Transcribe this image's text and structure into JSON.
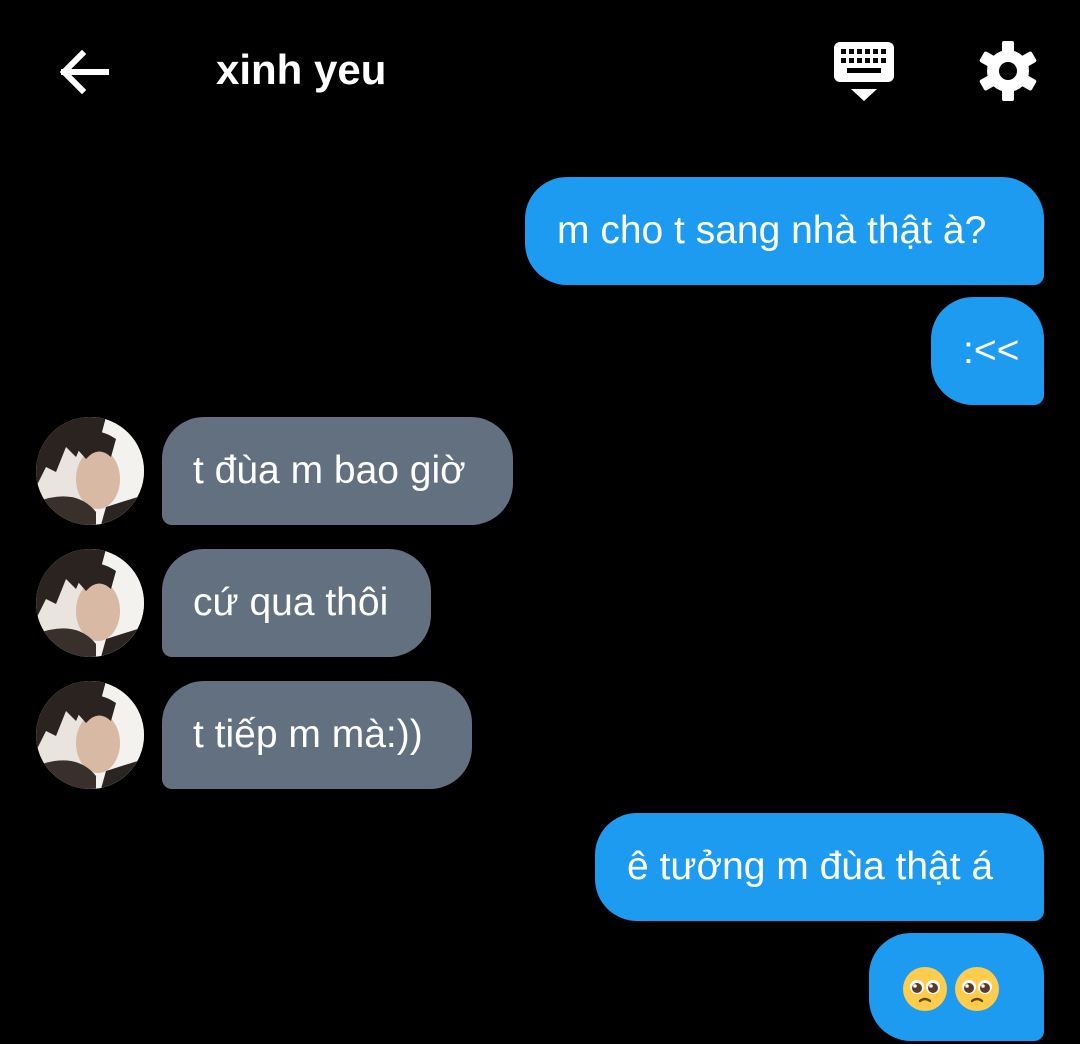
{
  "header": {
    "contact_name": "xinh yeu",
    "back_icon": "arrow-left-icon",
    "keyboard_icon": "keyboard-hide-icon",
    "settings_icon": "gear-icon"
  },
  "colors": {
    "background": "#000000",
    "outgoing_bubble": "#1d9bf0",
    "incoming_bubble": "#627080",
    "text": "#ffffff"
  },
  "messages": [
    {
      "direction": "outgoing",
      "text": "m cho t sang nhà thật à?"
    },
    {
      "direction": "outgoing",
      "text": ":<<"
    },
    {
      "direction": "incoming",
      "text": "t đùa m bao giờ"
    },
    {
      "direction": "incoming",
      "text": "cứ qua thôi"
    },
    {
      "direction": "incoming",
      "text": "t tiếp m mà:))"
    },
    {
      "direction": "outgoing",
      "text": "ê tưởng m đùa thật á"
    },
    {
      "direction": "outgoing",
      "text": "🥺🥺",
      "emoji_icon": "pleading-face-emoji"
    }
  ]
}
